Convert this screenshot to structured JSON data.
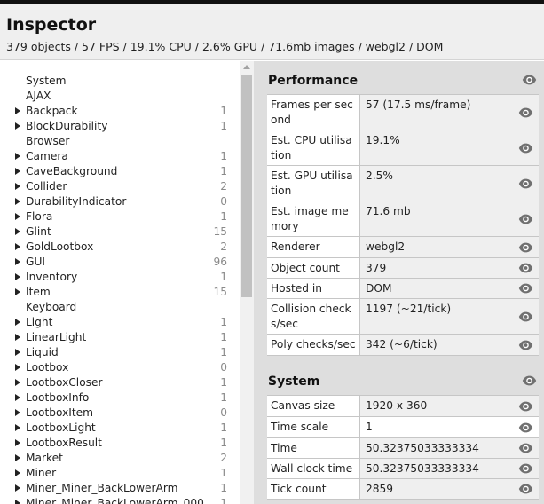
{
  "header": {
    "title": "Inspector",
    "stats": "379 objects / 57 FPS / 19.1% CPU / 2.6% GPU / 71.6mb images / webgl2 / DOM"
  },
  "tree": [
    {
      "name": "System",
      "expandable": false,
      "count": ""
    },
    {
      "name": "AJAX",
      "expandable": false,
      "count": ""
    },
    {
      "name": "Backpack",
      "expandable": true,
      "count": "1"
    },
    {
      "name": "BlockDurability",
      "expandable": true,
      "count": "1"
    },
    {
      "name": "Browser",
      "expandable": false,
      "count": ""
    },
    {
      "name": "Camera",
      "expandable": true,
      "count": "1"
    },
    {
      "name": "CaveBackground",
      "expandable": true,
      "count": "1"
    },
    {
      "name": "Collider",
      "expandable": true,
      "count": "2"
    },
    {
      "name": "DurabilityIndicator",
      "expandable": true,
      "count": "0"
    },
    {
      "name": "Flora",
      "expandable": true,
      "count": "1"
    },
    {
      "name": "Glint",
      "expandable": true,
      "count": "15"
    },
    {
      "name": "GoldLootbox",
      "expandable": true,
      "count": "2"
    },
    {
      "name": "GUI",
      "expandable": true,
      "count": "96"
    },
    {
      "name": "Inventory",
      "expandable": true,
      "count": "1"
    },
    {
      "name": "Item",
      "expandable": true,
      "count": "15"
    },
    {
      "name": "Keyboard",
      "expandable": false,
      "count": ""
    },
    {
      "name": "Light",
      "expandable": true,
      "count": "1"
    },
    {
      "name": "LinearLight",
      "expandable": true,
      "count": "1"
    },
    {
      "name": "Liquid",
      "expandable": true,
      "count": "1"
    },
    {
      "name": "Lootbox",
      "expandable": true,
      "count": "0"
    },
    {
      "name": "LootboxCloser",
      "expandable": true,
      "count": "1"
    },
    {
      "name": "LootboxInfo",
      "expandable": true,
      "count": "1"
    },
    {
      "name": "LootboxItem",
      "expandable": true,
      "count": "0"
    },
    {
      "name": "LootboxLight",
      "expandable": true,
      "count": "1"
    },
    {
      "name": "LootboxResult",
      "expandable": true,
      "count": "1"
    },
    {
      "name": "Market",
      "expandable": true,
      "count": "2"
    },
    {
      "name": "Miner",
      "expandable": true,
      "count": "1"
    },
    {
      "name": "Miner_Miner_BackLowerArm",
      "expandable": true,
      "count": "1"
    },
    {
      "name": "Miner_Miner_BackLowerArm_000",
      "expandable": true,
      "count": "1"
    }
  ],
  "performance": {
    "title": "Performance",
    "rows": [
      {
        "key": "Frames per second",
        "value": "57 (17.5 ms/frame)"
      },
      {
        "key": "Est. CPU utilisation",
        "value": "19.1%"
      },
      {
        "key": "Est. GPU utilisation",
        "value": "2.5%"
      },
      {
        "key": "Est. image memory",
        "value": "71.6 mb"
      },
      {
        "key": "Renderer",
        "value": "webgl2"
      },
      {
        "key": "Object count",
        "value": "379"
      },
      {
        "key": "Hosted in",
        "value": "DOM"
      },
      {
        "key": "Collision checks/sec",
        "value": "1197 (~21/tick)"
      },
      {
        "key": "Poly checks/sec",
        "value": "342 (~6/tick)"
      }
    ]
  },
  "system": {
    "title": "System",
    "rows": [
      {
        "key": "Canvas size",
        "value": "1920 x 360"
      },
      {
        "key": "Time scale",
        "value": "1"
      },
      {
        "key": "Time",
        "value": "50.32375033333334"
      },
      {
        "key": "Wall clock time",
        "value": "50.32375033333334"
      },
      {
        "key": "Tick count",
        "value": "2859"
      }
    ]
  },
  "icons": {
    "watch": "eye-icon",
    "expand": "triangle-right-icon"
  },
  "colors": {
    "header_bg": "#efefef",
    "panel_bg": "#dedede",
    "icon": "#707070"
  }
}
